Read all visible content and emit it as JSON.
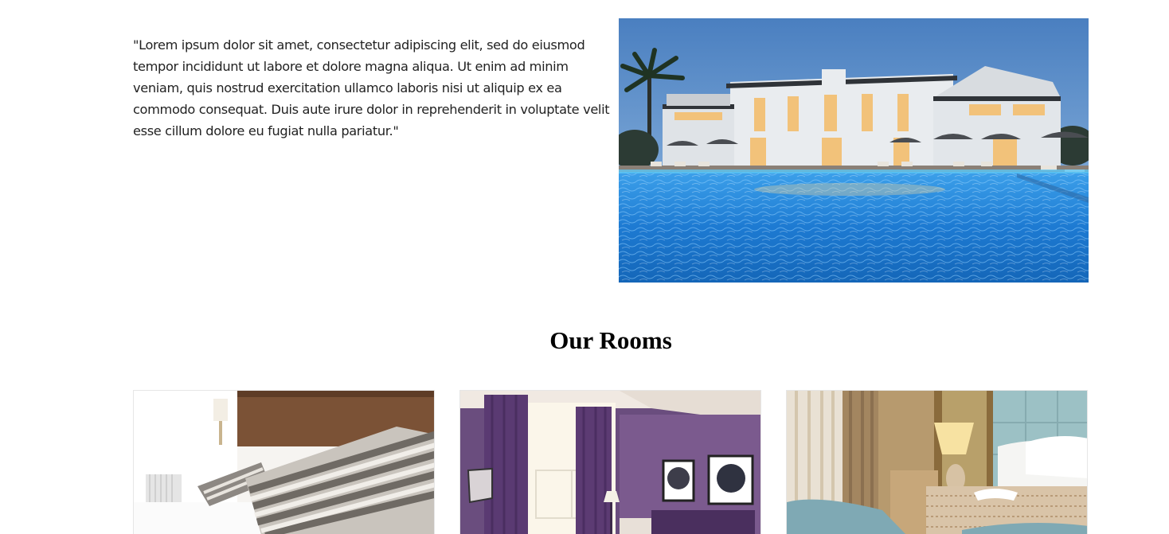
{
  "about": {
    "quote": "\"Lorem ipsum dolor sit amet, consectetur adipiscing elit, sed do eiusmod tempor incididunt ut labore et dolore magna aliqua. Ut enim ad minim veniam, quis nostrud exercitation ullamco laboris nisi ut aliquip ex ea commodo consequat. Duis aute irure dolor in reprehenderit in voluptate velit esse cillum dolore eu fugiat nulla pariatur.\""
  },
  "rooms": {
    "title": "Our Rooms"
  },
  "colors": {
    "sky": "#4f86c6",
    "pool": "#1f7fd6",
    "purple_room": "#5b3f6e",
    "teal_headboard": "#8fb5bb"
  }
}
